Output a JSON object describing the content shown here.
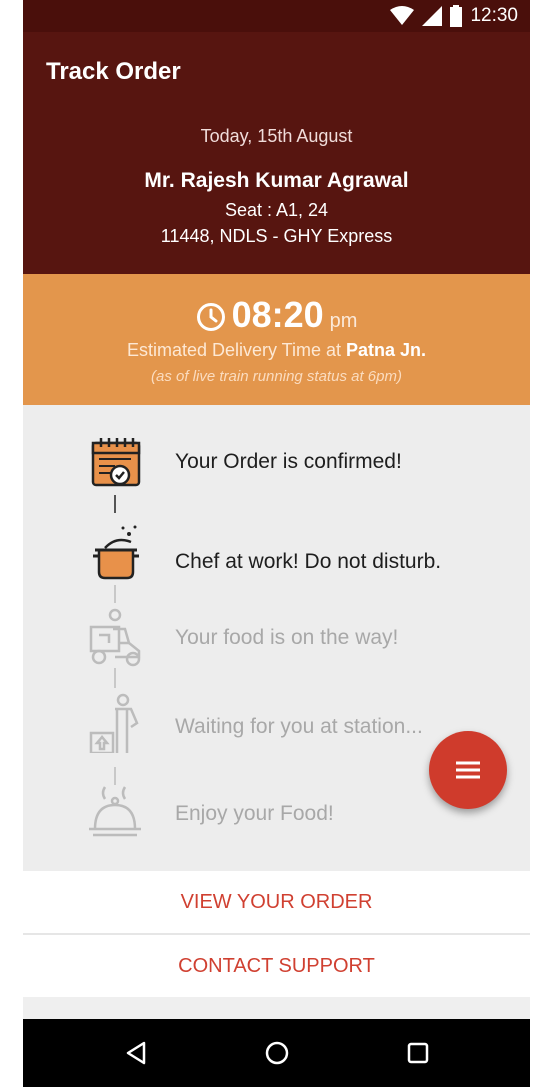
{
  "status_bar": {
    "time": "12:30",
    "icons": [
      "wifi-icon",
      "signal-icon",
      "battery-icon"
    ]
  },
  "app_bar": {
    "title": "Track Order"
  },
  "order": {
    "date": "Today, 15th August",
    "customer_name": "Mr. Rajesh Kumar Agrawal",
    "seat": "Seat : A1, 24",
    "train": "11448, NDLS - GHY Express"
  },
  "eta": {
    "time": "08:20",
    "meridiem": "pm",
    "label_prefix": "Estimated Delivery Time at",
    "station": "Patna Jn.",
    "note": "(as of live train running status at 6pm)"
  },
  "steps": [
    {
      "label": "Your Order is confirmed!",
      "icon": "calendar-check-icon",
      "state": "active"
    },
    {
      "label": "Chef at work! Do not disturb.",
      "icon": "cooking-pot-icon",
      "state": "active"
    },
    {
      "label": "Your food is on the way!",
      "icon": "delivery-scooter-icon",
      "state": "inactive"
    },
    {
      "label": "Waiting for you at station...",
      "icon": "delivery-person-icon",
      "state": "inactive"
    },
    {
      "label": "Enjoy your Food!",
      "icon": "food-cloche-icon",
      "state": "inactive"
    }
  ],
  "actions": {
    "view_order": "VIEW YOUR ORDER",
    "contact_support": "CONTACT SUPPORT"
  },
  "fab": {
    "icon": "menu-icon"
  },
  "nav_bar": {
    "icons": [
      "back-icon",
      "home-icon",
      "recents-icon"
    ]
  },
  "colors": {
    "primary_dark": "#571510",
    "accent_orange": "#e3964c",
    "action_red": "#d04031",
    "fab_red": "#cf3b2c",
    "icon_orange": "#e8914a"
  }
}
